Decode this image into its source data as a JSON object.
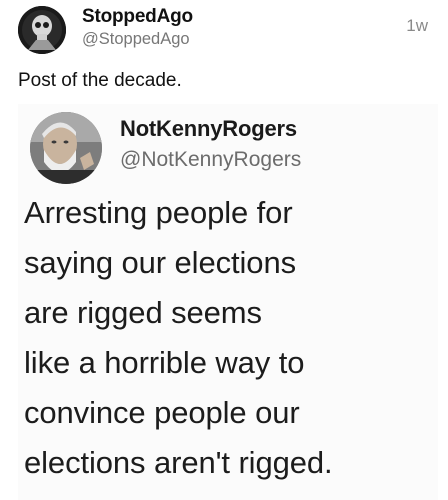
{
  "post": {
    "author_name": "StoppedAgo",
    "author_handle": "@StoppedAgo",
    "timestamp": "1w",
    "text": "Post of the decade.",
    "avatar_icon": "skull-avatar-icon"
  },
  "embedded_post": {
    "author_name": "NotKennyRogers",
    "author_handle": "@NotKennyRogers",
    "avatar_icon": "bearded-man-avatar-icon",
    "body_lines": [
      "Arresting people for",
      "saying our elections",
      "are rigged seems",
      "like a horrible way to",
      "convince people our",
      "elections aren't rigged."
    ]
  }
}
